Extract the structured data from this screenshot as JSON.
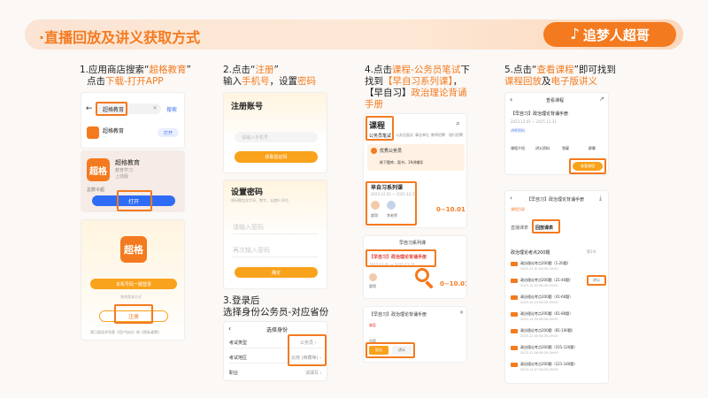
{
  "header": {
    "title": "·直播回放及讲义获取方式",
    "brand_icon": "tiktok-note-icon",
    "brand_text": "追梦人超哥",
    "accent": "#f47a1f"
  },
  "step1": {
    "line1_prefix": "1.应用商店搜索“",
    "line1_hl": "超格教育",
    "line1_suffix": "”",
    "line2_prefix": "点击",
    "line2_hl": "下载-打开APP",
    "search_back": "←",
    "search_value": "超格教育",
    "search_clear": "×",
    "search_btn": "搜索",
    "result_app": "超格教育",
    "result_sub": "...",
    "result_action": "打开",
    "card_logo": "超格",
    "card_name": "超格教育",
    "card_sub": "教育学习",
    "card_sub2": "上线版",
    "card_note": "总数令超",
    "open_button": "打开",
    "logo_big": "超格",
    "login_button": "本机号码一键登录",
    "other_login": "其他登录方式",
    "register_button": "注册",
    "agree_text": "我已阅读并同意《用户协议》和《隐私政策》"
  },
  "step2": {
    "line1_prefix": "2.点击“",
    "line1_hl": "注册",
    "line1_suffix": "”",
    "line2_prefix": "输入",
    "line2_hl1": "手机号",
    "line2_mid": "，设置",
    "line2_hl2": "密码",
    "register_title": "注册账号",
    "phone_placeholder": "请输入手机号",
    "code_button": "获取验证码",
    "setpwd_title": "设置密码",
    "setpwd_hint": "密码需包含字母、数字，长度8-16位",
    "pwd1_placeholder": "请输入密码",
    "pwd2_placeholder": "再次输入密码",
    "confirm_button": "确定"
  },
  "step3": {
    "line1": "3.登录后",
    "line2": "选择身份公务员-对应省份",
    "back": "‹",
    "title": "选择身份",
    "row1_label": "考试类型",
    "row1_value": "公务员 ›",
    "row2_label": "考试地区",
    "row2_value": "云南 (西藏等) ›",
    "row3_label": "职业",
    "row3_value": "请填写 ›"
  },
  "step4": {
    "line1_prefix": "4.点击",
    "line1_hl": "课程-公务员笔试",
    "line1_suffix": "下",
    "line2_prefix": "找到",
    "line2_hl": "【早自习系列课】",
    "line2_suffix": "，",
    "line3_prefix": "【早自习】",
    "line3_hl": "政治理论背诵",
    "line4_hl": "手册",
    "tab_title": "课程",
    "tab_sub": "公务员笔试",
    "cats": [
      "公务员面试",
      "事业单位",
      "教师招聘",
      "银行招聘"
    ],
    "promo_title": "优秀公务员",
    "promo_sub": "练下题库，面书，19讲辅导",
    "series_title": "早自习系列课",
    "series_date": "2023.12.01 ~ 2025.12.31",
    "teacher1": "超哥",
    "teacher2": "李老师",
    "price1": "0~10.01",
    "list_title": "早自习系列课",
    "manual_title": "【早自习】政治理论背诵手册",
    "manual_date": "2023.12.01 ~ 2025.12.31",
    "teacher3": "超哥",
    "price2": "0~10.01",
    "sheet_title": "【早自习】政治理论背诵手册",
    "sheet_price": "¥0",
    "sheet_label": "内容",
    "sheet_opt1": "报名",
    "sheet_opt2": "讲义"
  },
  "step5": {
    "line1_prefix": "5.点击“",
    "line1_hl": "查看课程",
    "line1_suffix": "”即可找到",
    "line2_hl1": "课程回放",
    "line2_mid": "及",
    "line2_hl2": "电子版讲义",
    "nav_title": "查看课程",
    "course_title": "【早自习】政治理论背诵手册",
    "course_date": "2023.12.01 ~ 2025.12.31",
    "course_tag": "讲师资料",
    "action1": "课程介绍",
    "action2": "讲义资料",
    "action3": "答疑",
    "action4": "群聊",
    "view_button": "查看课程",
    "list_title": "【早自习】政治理论背诵手册",
    "list_sub": "课程目录",
    "tab1": "直播课表",
    "tab2": "回放课表",
    "count_text": "政治理论考点200题",
    "section": "第1节",
    "handout_btn": "讲义",
    "lessons": [
      {
        "title": "政治理论考点200题（1-20题）",
        "date": "2023.12.01 08:30-09:00"
      },
      {
        "title": "政治理论考点200题（21-40题）",
        "date": "2023.12.02 08:30-09:00"
      },
      {
        "title": "政治理论考点200题（41-60题）",
        "date": "2023.12.03 08:30-09:00"
      },
      {
        "title": "政治理论考点200题（61-80题）",
        "date": "2023.12.04 08:30-09:00"
      },
      {
        "title": "政治理论考点200题（81-100题）",
        "date": "2023.12.05 08:30-09:00"
      },
      {
        "title": "政治理论考点200题（101-120题）",
        "date": "2023.12.06 08:30-09:00"
      },
      {
        "title": "政治理论考点200题（121-140题）",
        "date": "2023.12.07 08:30-09:00"
      }
    ]
  }
}
